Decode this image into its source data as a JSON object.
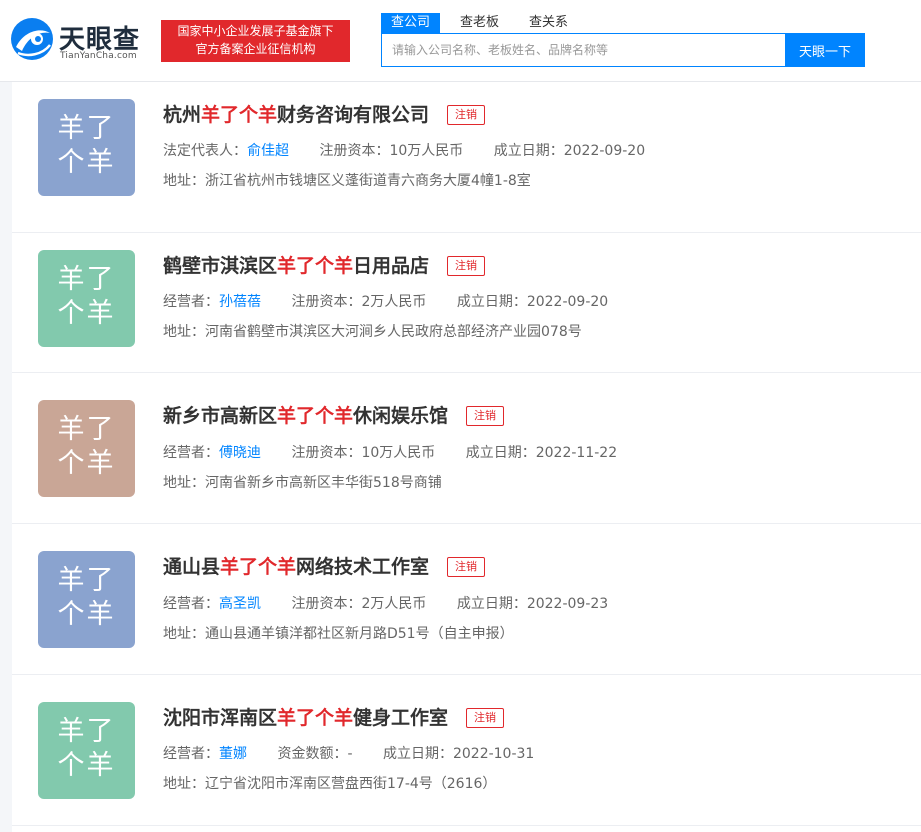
{
  "header": {
    "logo_text": "天眼查",
    "logo_sub": "TianYanCha.com",
    "slogan_line1": "国家中小企业发展子基金旗下",
    "slogan_line2": "官方备案企业征信机构",
    "tabs": [
      {
        "label": "查公司",
        "active": true
      },
      {
        "label": "查老板",
        "active": false
      },
      {
        "label": "查关系",
        "active": false
      }
    ],
    "search_placeholder": "请输入公司名称、老板姓名、品牌名称等",
    "search_button": "天眼一下"
  },
  "colors": {
    "accent": "#0084ff",
    "brand_red": "#e1282c",
    "avatar_blue": "#8aa3cf",
    "avatar_green": "#82c9ad",
    "avatar_brown": "#c9a696"
  },
  "companies": [
    {
      "avatar_line1": "羊了",
      "avatar_line2": "个羊",
      "avatar_color": "#8aa3cf",
      "name_pre": "杭州",
      "name_hl": "羊了个羊",
      "name_post": "财务咨询有限公司",
      "status": "注销",
      "rep_label": "法定代表人：",
      "rep_name": "俞佳超",
      "capital_label": "注册资本：",
      "capital": "10万人民币",
      "date_label": "成立日期：",
      "date": "2022-09-20",
      "address_label": "地址：",
      "address": "浙江省杭州市钱塘区义蓬街道青六商务大厦4幢1-8室"
    },
    {
      "avatar_line1": "羊了",
      "avatar_line2": "个羊",
      "avatar_color": "#82c9ad",
      "name_pre": "鹤壁市淇滨区",
      "name_hl": "羊了个羊",
      "name_post": "日用品店",
      "status": "注销",
      "rep_label": "经营者：",
      "rep_name": "孙蓓蓓",
      "capital_label": "注册资本：",
      "capital": "2万人民币",
      "date_label": "成立日期：",
      "date": "2022-09-20",
      "address_label": "地址：",
      "address": "河南省鹤壁市淇滨区大河涧乡人民政府总部经济产业园078号"
    },
    {
      "avatar_line1": "羊了",
      "avatar_line2": "个羊",
      "avatar_color": "#c9a696",
      "name_pre": "新乡市高新区",
      "name_hl": "羊了个羊",
      "name_post": "休闲娱乐馆",
      "status": "注销",
      "rep_label": "经营者：",
      "rep_name": "傅晓迪",
      "capital_label": "注册资本：",
      "capital": "10万人民币",
      "date_label": "成立日期：",
      "date": "2022-11-22",
      "address_label": "地址：",
      "address": "河南省新乡市高新区丰华街518号商铺"
    },
    {
      "avatar_line1": "羊了",
      "avatar_line2": "个羊",
      "avatar_color": "#8aa3cf",
      "name_pre": "通山县",
      "name_hl": "羊了个羊",
      "name_post": "网络技术工作室",
      "status": "注销",
      "rep_label": "经营者：",
      "rep_name": "高圣凯",
      "capital_label": "注册资本：",
      "capital": "2万人民币",
      "date_label": "成立日期：",
      "date": "2022-09-23",
      "address_label": "地址：",
      "address": "通山县通羊镇洋都社区新月路D51号（自主申报）"
    },
    {
      "avatar_line1": "羊了",
      "avatar_line2": "个羊",
      "avatar_color": "#82c9ad",
      "name_pre": "沈阳市浑南区",
      "name_hl": "羊了个羊",
      "name_post": "健身工作室",
      "status": "注销",
      "rep_label": "经营者：",
      "rep_name": "董娜",
      "capital_label": "资金数额：",
      "capital": "-",
      "date_label": "成立日期：",
      "date": "2022-10-31",
      "address_label": "地址：",
      "address": "辽宁省沈阳市浑南区营盘西街17-4号（2616）"
    }
  ]
}
